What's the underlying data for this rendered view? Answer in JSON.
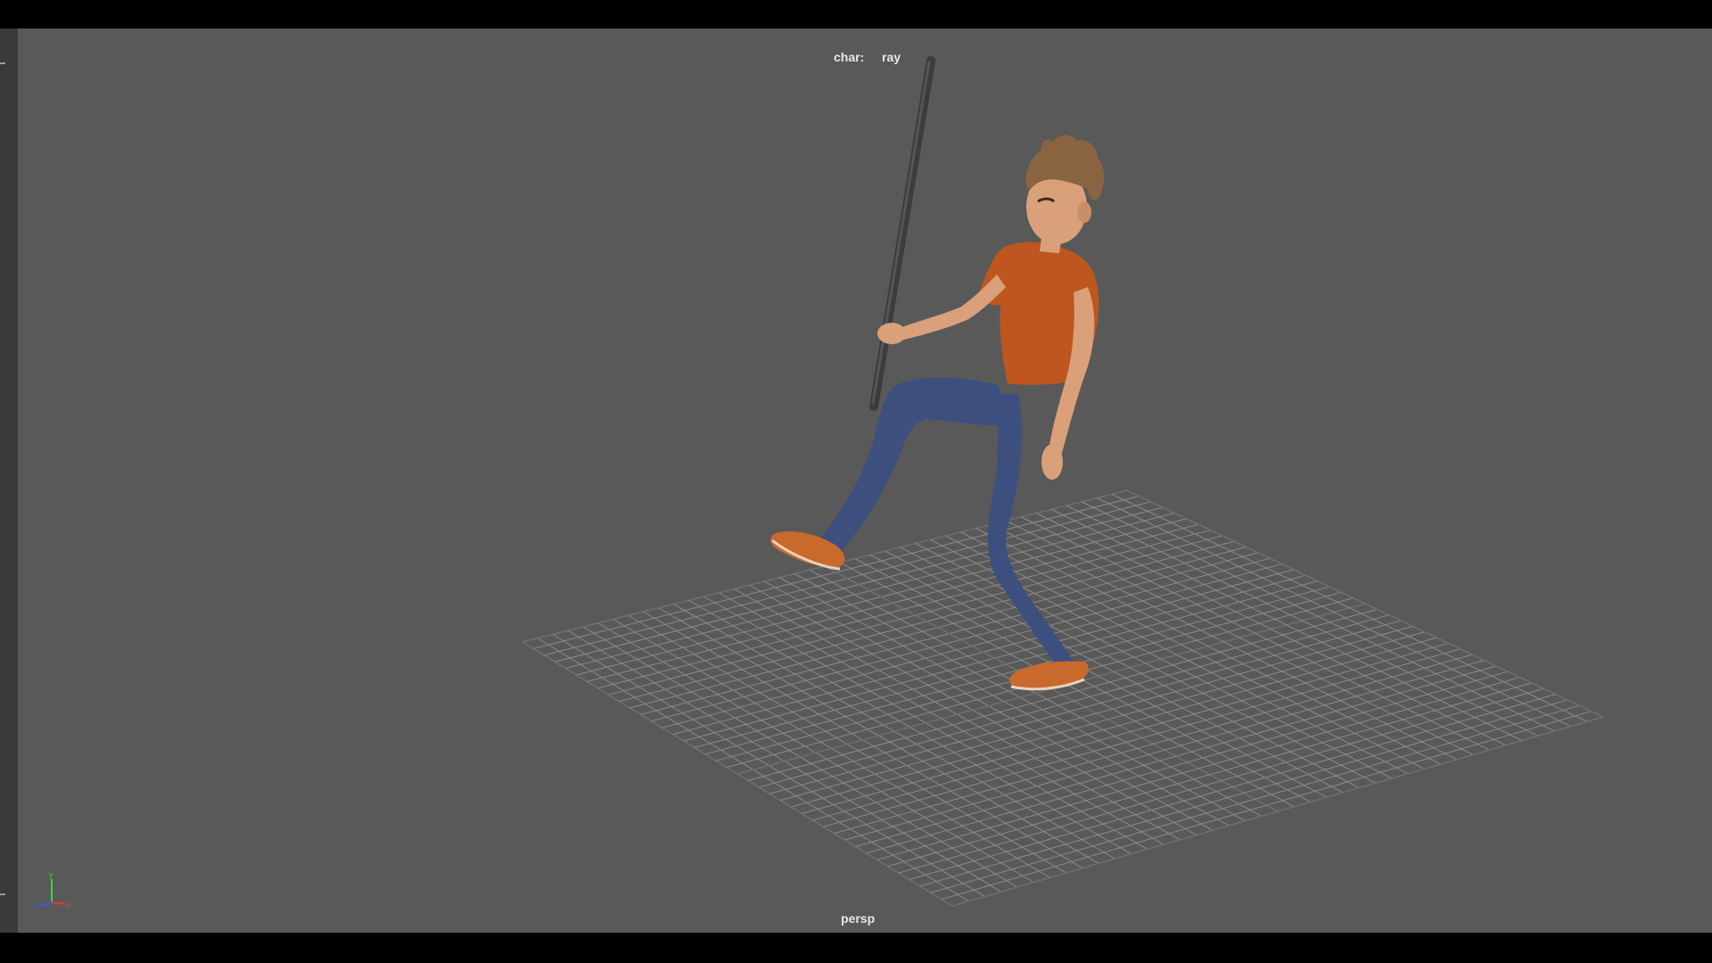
{
  "viewport": {
    "hud": {
      "char_label": "char:",
      "char_value": "ray",
      "camera_name": "persp"
    },
    "axis_gizmo": {
      "labels": {
        "y": "y",
        "x": "x",
        "z": "z"
      },
      "colors": {
        "y": "#3cd13c",
        "x": "#e03c3c",
        "z": "#3c5ce0"
      }
    },
    "colors": {
      "background": "#595959",
      "grid": "#8a8a8a",
      "shirt": "#c0561f",
      "jeans": "#3d4f7f",
      "shoes": "#c96a2c",
      "skin": "#d9a07a",
      "hair": "#8a6440",
      "staff": "#3a3a3a"
    }
  }
}
